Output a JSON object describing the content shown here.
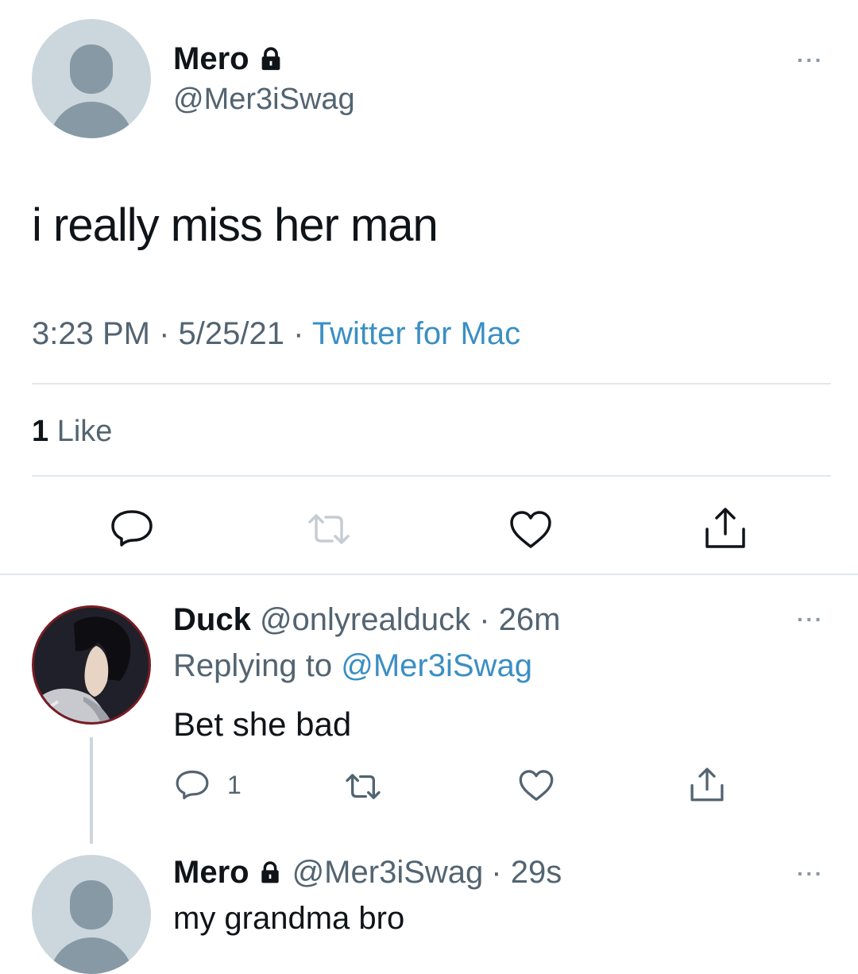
{
  "main_tweet": {
    "display_name": "Mero",
    "handle": "@Mer3iSwag",
    "text": "i really miss her man",
    "time": "3:23 PM",
    "date": "5/25/21",
    "separator": "·",
    "source": "Twitter for Mac",
    "likes_count": "1",
    "likes_label": "Like",
    "more_label": "···"
  },
  "reply": {
    "display_name": "Duck",
    "handle": "@onlyrealduck",
    "age": "· 26m",
    "replying_prefix": "Replying to",
    "replying_to": "@Mer3iSwag",
    "text": "Bet she bad",
    "reply_count": "1",
    "more_label": "···"
  },
  "reply2": {
    "display_name": "Mero",
    "handle": "@Mer3iSwag",
    "age": "· 29s",
    "text": "my grandma bro",
    "more_label": "···"
  },
  "colors": {
    "link": "#3b8fc4",
    "muted": "#536471",
    "divider": "#e1e8ed",
    "avatar_bg": "#ccd6dd",
    "avatar_fg": "#8899a6"
  },
  "icons": [
    "lock-icon",
    "reply-icon",
    "retweet-icon",
    "like-icon",
    "share-icon",
    "more-icon"
  ]
}
